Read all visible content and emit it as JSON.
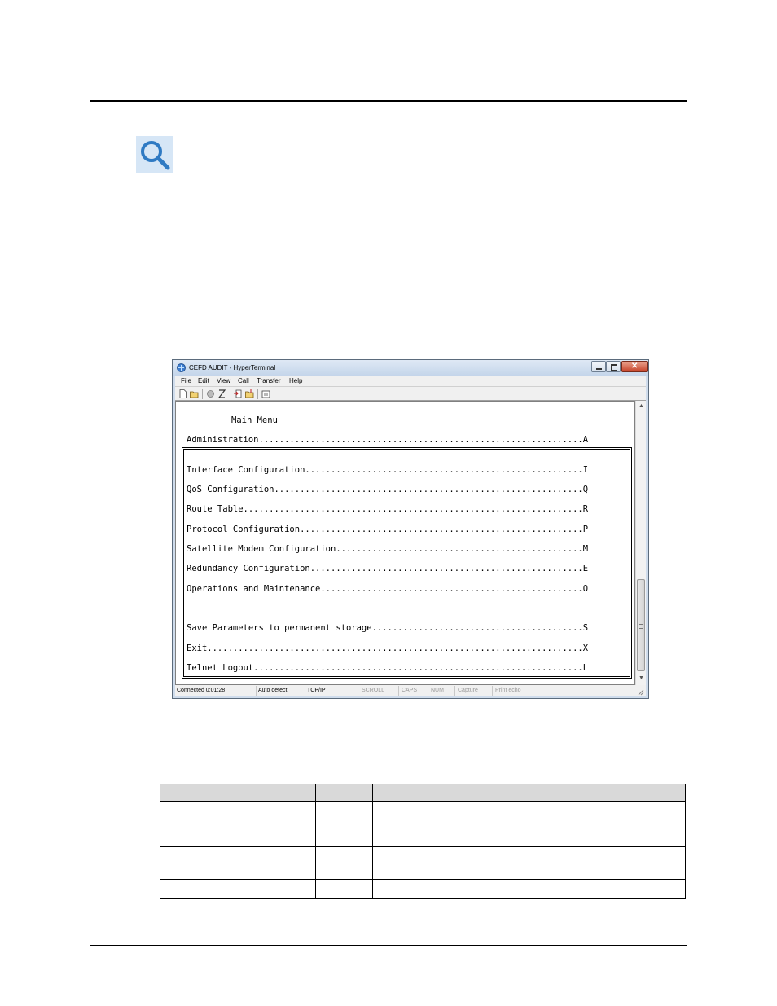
{
  "window": {
    "title": "CEFD AUDIT - HyperTerminal",
    "menu": [
      "File",
      "Edit",
      "View",
      "Call",
      "Transfer",
      "Help"
    ],
    "toolbar_icons": [
      "new-icon",
      "open-icon",
      "disconnect-icon",
      "connect-icon",
      "send-icon",
      "receive-icon",
      "properties-icon"
    ],
    "close_label": "✕"
  },
  "terminal": {
    "heading": "Main Menu",
    "lines": [
      "Administration...............................................................A",
      "Interface Configuration......................................................I",
      "QoS Configuration............................................................Q",
      "Route Table..................................................................R",
      "Protocol Configuration.......................................................P",
      "Satellite Modem Configuration................................................M",
      "Redundancy Configuration.....................................................E",
      "Operations and Maintenance...................................................O",
      "Save Parameters to permanent storage.........................................S",
      "Exit.........................................................................X",
      "Telnet Logout................................................................L"
    ]
  },
  "statusbar": [
    "Connected 0:01:28",
    "Auto detect",
    "TCP/IP",
    "SCROLL",
    "CAPS",
    "NUM",
    "Capture",
    "Print echo"
  ],
  "colors": {
    "icon_blue": "#3a7fc4",
    "title_gradient_top": "#dfe9f5",
    "table_header": "#d9d9d9"
  }
}
